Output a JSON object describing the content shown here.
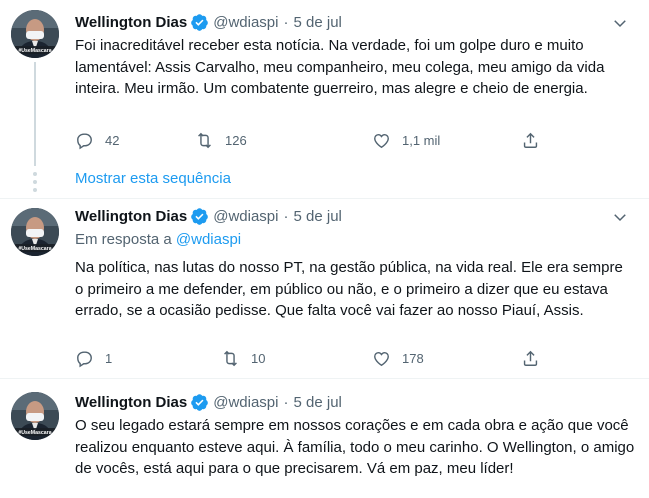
{
  "tweets": [
    {
      "author_name": "Wellington Dias",
      "handle": "@wdiaspi",
      "date": "5 de jul",
      "separator": "·",
      "text": "Foi inacreditável receber esta notícia. Na verdade, foi um golpe duro e muito lamentável: Assis Carvalho, meu companheiro, meu colega, meu amigo da vida inteira. Meu irmão. Um combatente guerreiro, mas alegre e cheio de energia.",
      "reply_count": "42",
      "retweet_count": "126",
      "like_count": "1,1 mil"
    },
    {
      "author_name": "Wellington Dias",
      "handle": "@wdiaspi",
      "date": "5 de jul",
      "separator": "·",
      "reply_prefix": "Em resposta a ",
      "reply_handle": "@wdiaspi",
      "text": "Na política, nas lutas do nosso PT, na gestão pública, na vida real. Ele era sempre o primeiro a me defender, em público ou não, e o primeiro a dizer que eu estava errado, se a ocasião pedisse. Que falta você vai fazer ao nosso Piauí, Assis.",
      "reply_count": "1",
      "retweet_count": "10",
      "like_count": "178"
    },
    {
      "author_name": "Wellington Dias",
      "handle": "@wdiaspi",
      "date": "5 de jul",
      "separator": "·",
      "text": "O seu legado estará sempre em nossos corações e em cada obra e ação que você realizou enquanto esteve aqui. À família, todo o meu carinho. O Wellington, o amigo de vocês, está aqui para o que precisarem. Vá em paz, meu líder!"
    }
  ],
  "show_thread_label": "Mostrar esta sequência",
  "avatar_badge": "#UseMascara",
  "colors": {
    "accent": "#1d9bf0",
    "secondary_text": "#536471",
    "thread_line": "#cfd9de"
  }
}
